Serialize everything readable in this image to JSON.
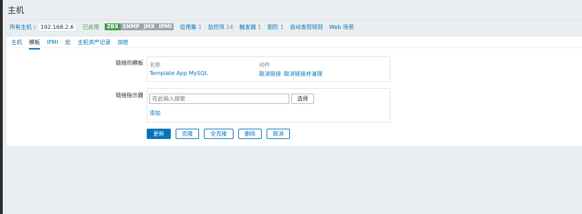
{
  "page": {
    "title": "主机"
  },
  "breadcrumb": {
    "all_hosts": "所有主机",
    "separator": "/",
    "host": "192.168.2.6",
    "status": "已启用",
    "availability": [
      "ZBX",
      "SNMP",
      "JMX",
      "IPMI"
    ],
    "links": [
      {
        "label": "应用集",
        "count": "1"
      },
      {
        "label": "监控项",
        "count": "14"
      },
      {
        "label": "触发器",
        "count": "1"
      },
      {
        "label": "图形",
        "count": "1"
      },
      {
        "label": "自动发现规则",
        "count": ""
      },
      {
        "label": "Web 场景",
        "count": ""
      }
    ]
  },
  "tabs": [
    "主机",
    "模板",
    "IPMI",
    "宏",
    "主机资产记录",
    "加密"
  ],
  "active_tab": "模板",
  "linked_templates": {
    "label": "链接的模板",
    "col_name": "名称",
    "col_action": "动作",
    "rows": [
      {
        "name": "Template App MySQL",
        "unlink": "取消链接",
        "unlink_clear": "取消链接并清理"
      }
    ]
  },
  "link_indicator": {
    "label": "链接指示器",
    "placeholder": "在此输入搜索",
    "select_label": "选择",
    "add_label": "添加"
  },
  "actions": {
    "update": "更新",
    "clone": "克隆",
    "full_clone": "全克隆",
    "delete": "删除",
    "cancel": "取消"
  },
  "colors": {
    "link": "#0275b8",
    "enabled": "#429e47",
    "badge_zbx": "#429e47",
    "badge_grey": "#9ca5aa"
  }
}
